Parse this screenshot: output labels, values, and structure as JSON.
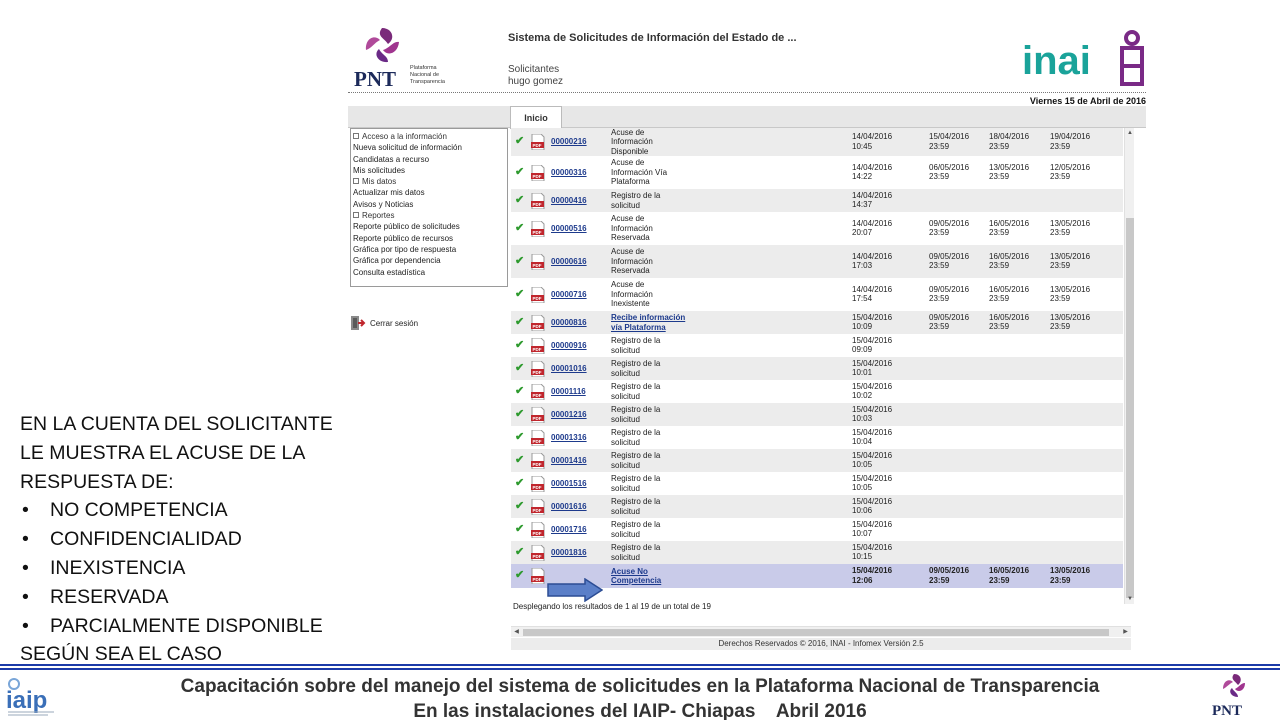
{
  "annotation": {
    "lines": [
      "EN LA CUENTA DEL  SOLICITANTE",
      "LE MUESTRA EL ACUSE DE LA",
      "RESPUESTA DE:"
    ],
    "bullets": [
      "NO COMPETENCIA",
      "CONFIDENCIALIDAD",
      "INEXISTENCIA",
      "RESERVADA",
      "PARCIALMENTE DISPONIBLE"
    ],
    "closing": "SEGÚN SEA EL CASO"
  },
  "header": {
    "pnt_logo_text": "PNT",
    "pnt_logo_caption": "Plataforma Nacional de Transparencia",
    "system_title": "Sistema de Solicitudes de Información del Estado de ...",
    "user_type": "Solicitantes",
    "user_name": "hugo gomez",
    "inai_logo_text": "inai",
    "date": "Viernes 15 de Abril de 2016"
  },
  "tabs": [
    {
      "label": "Inicio"
    }
  ],
  "menu": [
    {
      "label": "Acceso a la información",
      "section": true
    },
    {
      "label": "Nueva solicitud de información"
    },
    {
      "label": "Candidatas a recurso"
    },
    {
      "label": "Mis solicitudes"
    },
    {
      "label": "Mis datos",
      "section": true
    },
    {
      "label": "Actualizar mis datos"
    },
    {
      "label": "Avisos y Noticias"
    },
    {
      "label": "Reportes",
      "section": true
    },
    {
      "label": "Reporte público de solicitudes"
    },
    {
      "label": "Reporte público de recursos"
    },
    {
      "label": "Gráfica por tipo de respuesta"
    },
    {
      "label": "Gráfica por dependencia"
    },
    {
      "label": "Consulta estadística"
    }
  ],
  "logout": {
    "label": "Cerrar sesión"
  },
  "grid": {
    "rows": [
      {
        "folio": "00000216",
        "status": [
          "Acuse de",
          "Información",
          "Disponible"
        ],
        "d1": [
          "14/04/2016",
          "10:45"
        ],
        "d2": [
          "15/04/2016",
          "23:59"
        ],
        "d3": [
          "18/04/2016",
          "23:59"
        ],
        "d4": [
          "19/04/2016",
          "23:59"
        ]
      },
      {
        "folio": "00000316",
        "status": [
          "Acuse de",
          "Información Vía",
          "Plataforma"
        ],
        "d1": [
          "14/04/2016",
          "14:22"
        ],
        "d2": [
          "06/05/2016",
          "23:59"
        ],
        "d3": [
          "13/05/2016",
          "23:59"
        ],
        "d4": [
          "12/05/2016",
          "23:59"
        ]
      },
      {
        "folio": "00000416",
        "status": [
          "Registro de la",
          "solicitud"
        ],
        "d1": [
          "14/04/2016",
          "14:37"
        ]
      },
      {
        "folio": "00000516",
        "status": [
          "Acuse de",
          "Información",
          "Reservada"
        ],
        "d1": [
          "14/04/2016",
          "20:07"
        ],
        "d2": [
          "09/05/2016",
          "23:59"
        ],
        "d3": [
          "16/05/2016",
          "23:59"
        ],
        "d4": [
          "13/05/2016",
          "23:59"
        ]
      },
      {
        "folio": "00000616",
        "status": [
          "Acuse de",
          "Información",
          "Reservada"
        ],
        "d1": [
          "14/04/2016",
          "17:03"
        ],
        "d2": [
          "09/05/2016",
          "23:59"
        ],
        "d3": [
          "16/05/2016",
          "23:59"
        ],
        "d4": [
          "13/05/2016",
          "23:59"
        ]
      },
      {
        "folio": "00000716",
        "status": [
          "Acuse de",
          "Información",
          "Inexistente"
        ],
        "d1": [
          "14/04/2016",
          "17:54"
        ],
        "d2": [
          "09/05/2016",
          "23:59"
        ],
        "d3": [
          "16/05/2016",
          "23:59"
        ],
        "d4": [
          "13/05/2016",
          "23:59"
        ]
      },
      {
        "folio": "00000816",
        "status": [
          "Recibe información",
          "vía Plataforma"
        ],
        "link": true,
        "d1": [
          "15/04/2016",
          "10:09"
        ],
        "d2": [
          "09/05/2016",
          "23:59"
        ],
        "d3": [
          "16/05/2016",
          "23:59"
        ],
        "d4": [
          "13/05/2016",
          "23:59"
        ]
      },
      {
        "folio": "00000916",
        "status": [
          "Registro de la",
          "solicitud"
        ],
        "d1": [
          "15/04/2016",
          "09:09"
        ]
      },
      {
        "folio": "00001016",
        "status": [
          "Registro de la",
          "solicitud"
        ],
        "d1": [
          "15/04/2016",
          "10:01"
        ]
      },
      {
        "folio": "00001116",
        "status": [
          "Registro de la",
          "solicitud"
        ],
        "d1": [
          "15/04/2016",
          "10:02"
        ]
      },
      {
        "folio": "00001216",
        "status": [
          "Registro de la",
          "solicitud"
        ],
        "d1": [
          "15/04/2016",
          "10:03"
        ]
      },
      {
        "folio": "00001316",
        "status": [
          "Registro de la",
          "solicitud"
        ],
        "d1": [
          "15/04/2016",
          "10:04"
        ]
      },
      {
        "folio": "00001416",
        "status": [
          "Registro de la",
          "solicitud"
        ],
        "d1": [
          "15/04/2016",
          "10:05"
        ]
      },
      {
        "folio": "00001516",
        "status": [
          "Registro de la",
          "solicitud"
        ],
        "d1": [
          "15/04/2016",
          "10:05"
        ]
      },
      {
        "folio": "00001616",
        "status": [
          "Registro de la",
          "solicitud"
        ],
        "d1": [
          "15/04/2016",
          "10:06"
        ]
      },
      {
        "folio": "00001716",
        "status": [
          "Registro de la",
          "solicitud"
        ],
        "d1": [
          "15/04/2016",
          "10:07"
        ]
      },
      {
        "folio": "00001816",
        "status": [
          "Registro de la",
          "solicitud"
        ],
        "d1": [
          "15/04/2016",
          "10:15"
        ]
      },
      {
        "folio": "",
        "status": [
          "Acuse No",
          "Competencia"
        ],
        "link": true,
        "selected": true,
        "d1": [
          "15/04/2016",
          "12:06"
        ],
        "d2": [
          "09/05/2016",
          "23:59"
        ],
        "d3": [
          "16/05/2016",
          "23:59"
        ],
        "d4": [
          "13/05/2016",
          "23:59"
        ]
      }
    ],
    "footer": "Desplegando los resultados de 1 al 19 de un total de 19"
  },
  "copyright": "Derechos Reservados © 2016, INAI - Infomex Versión 2.5",
  "banner": {
    "line1": "Capacitación sobre del manejo del sistema de solicitudes en la Plataforma Nacional de Transparencia",
    "line2": "En las instalaciones del IAIP- Chiapas    Abril 2016",
    "iaip_logo_text": "iaip",
    "pnt_logo_text": "PNT"
  },
  "colors": {
    "accent_blue": "#1c3aa8",
    "inai_teal": "#1aa39a",
    "pnt_purple": "#7a2a7a",
    "check_green": "#2e9a2e",
    "pdf_red": "#c0262d",
    "selected_row": "#c9cbe9"
  }
}
